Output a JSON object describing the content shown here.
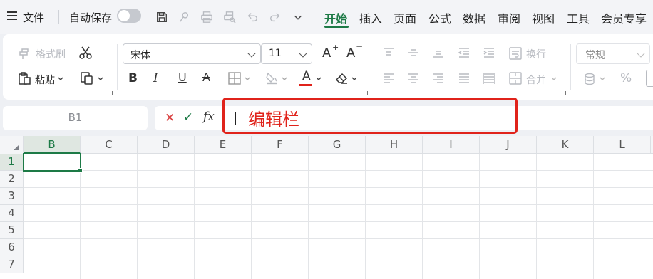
{
  "menubar": {
    "file_label": "文件",
    "autosave_label": "自动保存",
    "autosave_on": false,
    "tabs": [
      {
        "label": "开始",
        "active": true
      },
      {
        "label": "插入"
      },
      {
        "label": "页面"
      },
      {
        "label": "公式"
      },
      {
        "label": "数据"
      },
      {
        "label": "审阅"
      },
      {
        "label": "视图"
      },
      {
        "label": "工具"
      },
      {
        "label": "会员专享"
      }
    ],
    "quick_access_icons": [
      "save-icon",
      "format-painter-small-icon",
      "print-icon",
      "print-preview-icon",
      "undo-icon",
      "redo-icon",
      "more-chevron-icon"
    ]
  },
  "ribbon": {
    "format_painter_label": "格式刷",
    "paste_label": "粘贴",
    "font_name": "宋体",
    "font_size": "11",
    "wrap_label": "换行",
    "merge_label": "合并",
    "number_format": "常规",
    "percent_symbol": "%",
    "bold_glyph": "B",
    "italic_glyph": "I",
    "underline_glyph": "U",
    "strike_glyph": "A",
    "font_color_glyph": "A",
    "grow_font_glyph": "A",
    "shrink_font_glyph": "A",
    "accent_color": "#1d7a46",
    "font_color_bar": "#e0231b"
  },
  "formula_bar": {
    "name_box": "B1",
    "cancel_glyph": "✕",
    "confirm_glyph": "✓",
    "fx_label": "fx",
    "annotation_label": "编辑栏",
    "annotation_color": "#e0231b"
  },
  "sheet": {
    "columns": [
      "B",
      "C",
      "D",
      "E",
      "F",
      "G",
      "H",
      "I",
      "J",
      "K",
      "L"
    ],
    "rows": [
      "1",
      "2",
      "3",
      "4",
      "5",
      "6",
      "7"
    ],
    "active_cell": "B1"
  }
}
